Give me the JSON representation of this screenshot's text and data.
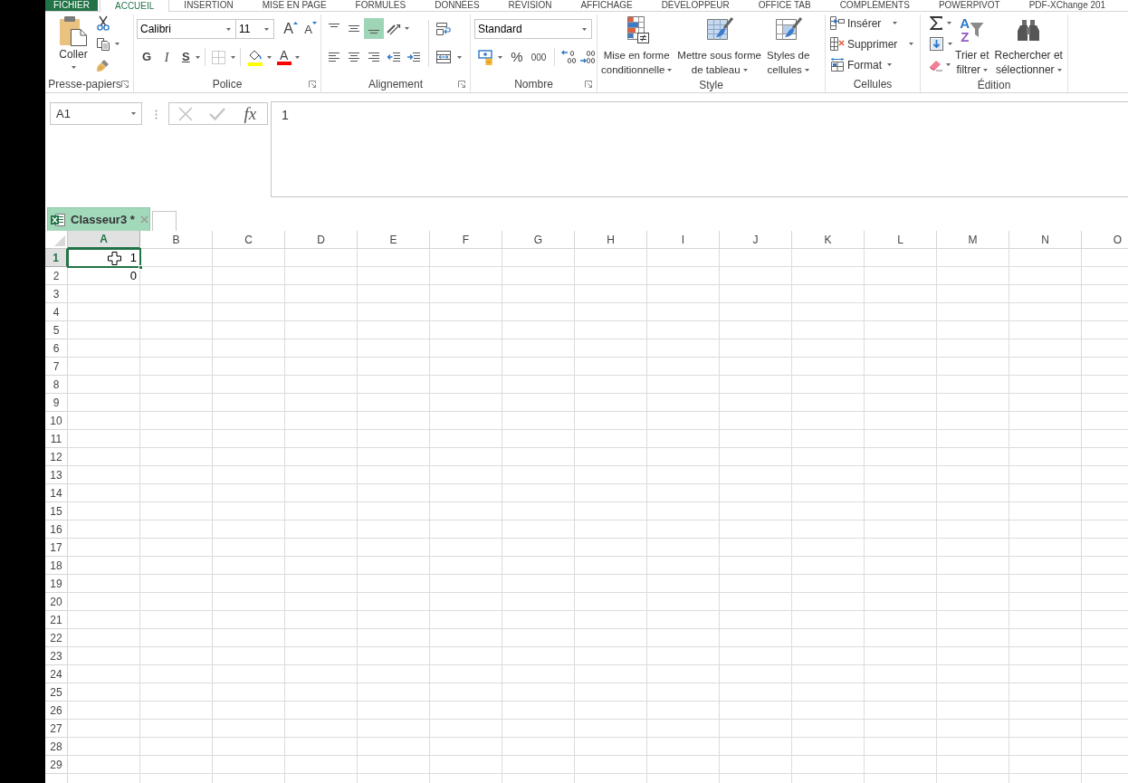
{
  "ribbon_tabs": [
    {
      "label": "FICHIER",
      "kind": "file",
      "selected": false
    },
    {
      "label": "ACCUEIL",
      "kind": "tab",
      "selected": true
    },
    {
      "label": "INSERTION",
      "kind": "tab",
      "selected": false
    },
    {
      "label": "MISE EN PAGE",
      "kind": "tab",
      "selected": false
    },
    {
      "label": "FORMULES",
      "kind": "tab",
      "selected": false
    },
    {
      "label": "DONNÉES",
      "kind": "tab",
      "selected": false
    },
    {
      "label": "RÉVISION",
      "kind": "tab",
      "selected": false
    },
    {
      "label": "AFFICHAGE",
      "kind": "tab",
      "selected": false
    },
    {
      "label": "DÉVELOPPEUR",
      "kind": "tab",
      "selected": false
    },
    {
      "label": "OFFICE TAB",
      "kind": "tab",
      "selected": false
    },
    {
      "label": "COMPLÉMENTS",
      "kind": "tab",
      "selected": false
    },
    {
      "label": "POWERPIVOT",
      "kind": "tab",
      "selected": false
    },
    {
      "label": "PDF-XChange 201",
      "kind": "tab",
      "selected": false
    }
  ],
  "clipboard": {
    "paste_label": "Coller",
    "group_label": "Presse-papiers"
  },
  "font": {
    "name": "Calibri",
    "size": "11",
    "grow": "A",
    "shrink": "A",
    "bold": "G",
    "italic": "I",
    "underline": "S",
    "font_color": "A",
    "group_label": "Police"
  },
  "alignment": {
    "vertical": [
      {
        "kind": "top",
        "selected": false
      },
      {
        "kind": "middle",
        "selected": false
      },
      {
        "kind": "bottom",
        "selected": true
      }
    ],
    "horizontal": [
      {
        "kind": "left",
        "selected": false
      },
      {
        "kind": "center",
        "selected": false
      },
      {
        "kind": "right",
        "selected": false
      }
    ],
    "group_label": "Alignement"
  },
  "number": {
    "format": "Standard",
    "percent": "%",
    "thousands": "000",
    "group_label": "Nombre"
  },
  "styles": {
    "buttons": [
      {
        "kind": "conditional",
        "lines": [
          "Mise en forme",
          "conditionnelle"
        ]
      },
      {
        "kind": "table",
        "lines": [
          "Mettre sous forme",
          "de tableau"
        ]
      },
      {
        "kind": "cell_styles",
        "lines": [
          "Styles de",
          "cellules"
        ]
      }
    ],
    "group_label": "Style"
  },
  "cells": {
    "buttons": [
      {
        "kind": "insert",
        "label": "Insérer"
      },
      {
        "kind": "delete",
        "label": "Supprimer"
      },
      {
        "kind": "format",
        "label": "Format"
      }
    ],
    "group_label": "Cellules"
  },
  "editing": {
    "sort_letters": [
      "A",
      "Z"
    ],
    "buttons": [
      {
        "kind": "sort",
        "lines": [
          "Trier et",
          "filtrer"
        ]
      },
      {
        "kind": "find",
        "lines": [
          "Rechercher et",
          "sélectionner"
        ]
      }
    ],
    "group_label": "Édition"
  },
  "formula_bar": {
    "name_box": "A1",
    "cancel": {
      "disabled": true
    },
    "enter": {
      "disabled": true
    },
    "function": "fx",
    "formula": "1"
  },
  "sheet_tabs": [
    {
      "label": "Classeur3 *",
      "selected": true
    }
  ],
  "grid": {
    "columns": [
      {
        "label": "A",
        "selected": true
      },
      {
        "label": "B",
        "selected": false
      },
      {
        "label": "C",
        "selected": false
      },
      {
        "label": "D",
        "selected": false
      },
      {
        "label": "E",
        "selected": false
      },
      {
        "label": "F",
        "selected": false
      },
      {
        "label": "G",
        "selected": false
      },
      {
        "label": "H",
        "selected": false
      },
      {
        "label": "I",
        "selected": false
      },
      {
        "label": "J",
        "selected": false
      },
      {
        "label": "K",
        "selected": false
      },
      {
        "label": "L",
        "selected": false
      },
      {
        "label": "M",
        "selected": false
      },
      {
        "label": "N",
        "selected": false
      },
      {
        "label": "O",
        "selected": false
      }
    ],
    "rows": [
      {
        "label": "1",
        "selected": true,
        "cells": [
          {
            "value": "1",
            "selected": true
          }
        ]
      },
      {
        "label": "2",
        "selected": false,
        "cells": [
          {
            "value": "0",
            "selected": false
          }
        ]
      },
      {
        "label": "3",
        "selected": false
      },
      {
        "label": "4",
        "selected": false
      },
      {
        "label": "5",
        "selected": false
      },
      {
        "label": "6",
        "selected": false
      },
      {
        "label": "7",
        "selected": false
      },
      {
        "label": "8",
        "selected": false
      },
      {
        "label": "9",
        "selected": false
      },
      {
        "label": "10",
        "selected": false
      },
      {
        "label": "11",
        "selected": false
      },
      {
        "label": "12",
        "selected": false
      },
      {
        "label": "13",
        "selected": false
      },
      {
        "label": "14",
        "selected": false
      },
      {
        "label": "15",
        "selected": false
      },
      {
        "label": "16",
        "selected": false
      },
      {
        "label": "17",
        "selected": false
      },
      {
        "label": "18",
        "selected": false
      },
      {
        "label": "19",
        "selected": false
      },
      {
        "label": "20",
        "selected": false
      },
      {
        "label": "21",
        "selected": false
      },
      {
        "label": "22",
        "selected": false
      },
      {
        "label": "23",
        "selected": false
      },
      {
        "label": "24",
        "selected": false
      },
      {
        "label": "25",
        "selected": false
      },
      {
        "label": "26",
        "selected": false
      },
      {
        "label": "27",
        "selected": false
      },
      {
        "label": "28",
        "selected": false
      },
      {
        "label": "29",
        "selected": false
      }
    ]
  }
}
